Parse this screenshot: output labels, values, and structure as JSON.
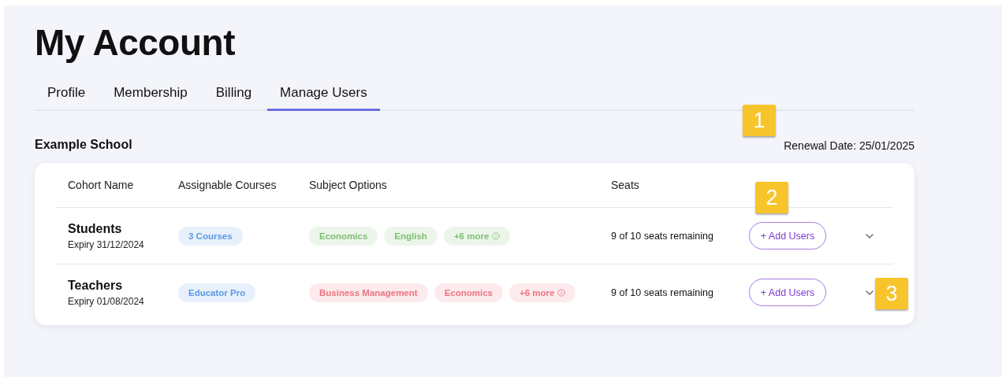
{
  "title": "My Account",
  "tabs": [
    {
      "label": "Profile",
      "selected": false
    },
    {
      "label": "Membership",
      "selected": false
    },
    {
      "label": "Billing",
      "selected": false
    },
    {
      "label": "Manage Users",
      "selected": true
    }
  ],
  "organisation": "Example School",
  "renewal": "Renewal Date: 25/01/2025",
  "table": {
    "columns": [
      "Cohort Name",
      "Assignable Courses",
      "Subject Options",
      "Seats"
    ],
    "rows": [
      {
        "name": "Students",
        "expiry": "Expiry 31/12/2024",
        "course": "3 Courses",
        "subjects": [
          {
            "label": "Economics",
            "color": "#7fbf74"
          },
          {
            "label": "English",
            "color": "#7fbf74"
          },
          {
            "label": "+6 more",
            "color": "#7fbf74",
            "info": true
          }
        ],
        "seats": "9 of 10 seats remaining",
        "action": "+ Add Users"
      },
      {
        "name": "Teachers",
        "expiry": "Expiry 01/08/2024",
        "course": "Educator Pro",
        "subjects": [
          {
            "label": "Business Management",
            "color": "#ee7480"
          },
          {
            "label": "Economics",
            "color": "#ee7480"
          },
          {
            "label": "+6 more",
            "color": "#ee7480",
            "info": true
          }
        ],
        "seats": "9 of 10 seats remaining",
        "action": "+ Add Users"
      }
    ]
  },
  "callouts": [
    "1",
    "2",
    "3"
  ]
}
